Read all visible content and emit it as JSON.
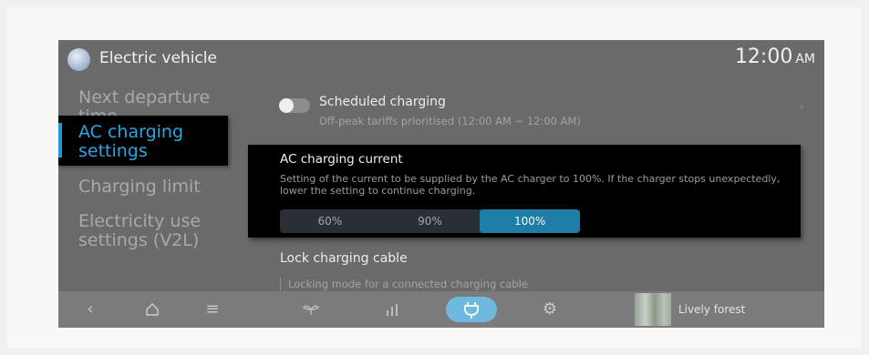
{
  "header": {
    "title": "Electric vehicle",
    "time": "12:00",
    "ampm": "AM"
  },
  "menu": {
    "items": [
      {
        "label": "Next departure time"
      },
      {
        "label": "AC charging settings",
        "active": true
      },
      {
        "label": "Charging limit"
      },
      {
        "label": "Electricity use settings (V2L)"
      }
    ]
  },
  "scheduled": {
    "title": "Scheduled charging",
    "subtitle": "Off-peak tariffs prioritised (12:00 AM ~ 12:00 AM)",
    "enabled": false
  },
  "ac_current": {
    "title": "AC charging current",
    "description": "Setting of the current to be supplied by the AC charger to 100%. If the charger stops unexpectedly, lower the setting to continue charging.",
    "options": [
      "60%",
      "90%",
      "100%"
    ],
    "selected": "100%"
  },
  "lock_cable": {
    "title": "Lock charging cable",
    "subtitle": "Locking mode for a connected charging cable"
  },
  "bottom_bar": {
    "icons": [
      "back-icon",
      "home-icon",
      "menu-icon",
      "leaf-icon",
      "bars-chart-icon",
      "charging-plug-icon",
      "settings-gear-icon"
    ],
    "active": "charging-plug-icon",
    "media_label": "Lively forest",
    "accent": "#6fb9df"
  },
  "colors": {
    "accent_blue": "#1e9bd7",
    "selected_segment": "#1f7ea8"
  }
}
